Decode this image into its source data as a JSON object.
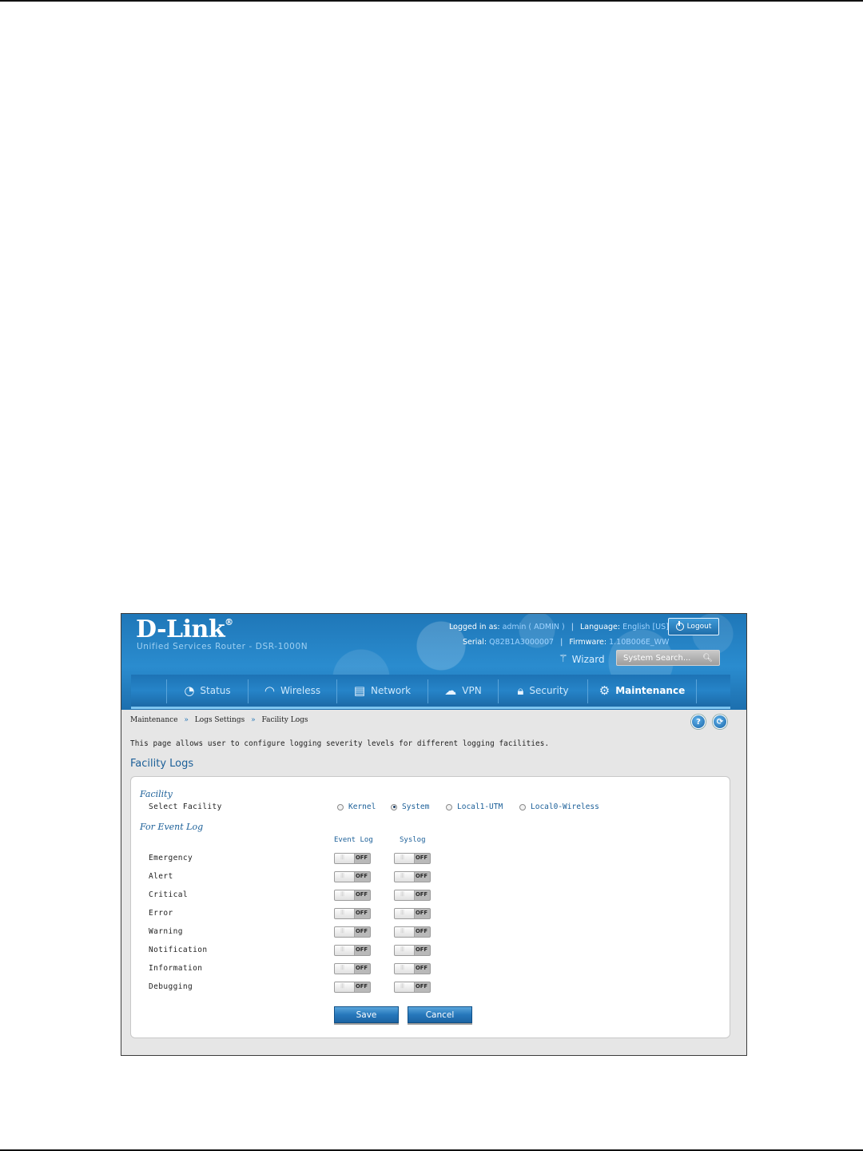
{
  "brand": {
    "logo": "D-Link",
    "logo_mark": "®",
    "product": "Unified Services Router - DSR-1000N"
  },
  "top_info": {
    "logged_in_label": "Logged in as:",
    "user": "admin ( ADMIN )",
    "language_label": "Language:",
    "language": "English [US]",
    "serial_label": "Serial:",
    "serial": "Q82B1A3000007",
    "firmware_label": "Firmware:",
    "firmware": "1.10B006E_WW",
    "logout": "Logout",
    "wizard": "Wizard",
    "search_placeholder": "System Search..."
  },
  "nav": {
    "items": [
      {
        "label": "Status",
        "icon": "gauge-icon"
      },
      {
        "label": "Wireless",
        "icon": "wifi-icon"
      },
      {
        "label": "Network",
        "icon": "server-icon"
      },
      {
        "label": "VPN",
        "icon": "cloud-lock-icon"
      },
      {
        "label": "Security",
        "icon": "lock-icon"
      },
      {
        "label": "Maintenance",
        "icon": "gears-icon"
      }
    ],
    "active": "Maintenance"
  },
  "breadcrumb": [
    "Maintenance",
    "Logs Settings",
    "Facility Logs"
  ],
  "breadcrumb_sep": "»",
  "help_buttons": [
    "?",
    "⟳"
  ],
  "description": "This page allows user to configure logging severity levels for different logging facilities.",
  "page_title": "Facility Logs",
  "facility": {
    "section_label": "Facility",
    "field_label": "Select Facility",
    "options": [
      "Kernel",
      "System",
      "Local1-UTM",
      "Local0-Wireless"
    ],
    "selected": "System"
  },
  "event_log": {
    "section_label": "For Event Log",
    "columns": [
      "Event Log",
      "Syslog"
    ],
    "toggle_state_label": "OFF",
    "levels": [
      {
        "name": "Emergency",
        "event_log": "OFF",
        "syslog": "OFF"
      },
      {
        "name": "Alert",
        "event_log": "OFF",
        "syslog": "OFF"
      },
      {
        "name": "Critical",
        "event_log": "OFF",
        "syslog": "OFF"
      },
      {
        "name": "Error",
        "event_log": "OFF",
        "syslog": "OFF"
      },
      {
        "name": "Warning",
        "event_log": "OFF",
        "syslog": "OFF"
      },
      {
        "name": "Notification",
        "event_log": "OFF",
        "syslog": "OFF"
      },
      {
        "name": "Information",
        "event_log": "OFF",
        "syslog": "OFF"
      },
      {
        "name": "Debugging",
        "event_log": "OFF",
        "syslog": "OFF"
      }
    ]
  },
  "actions": {
    "save": "Save",
    "cancel": "Cancel"
  }
}
